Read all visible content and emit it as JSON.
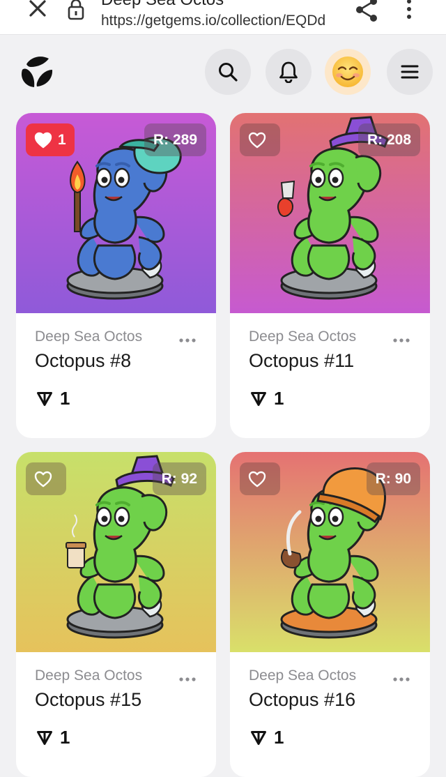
{
  "browser": {
    "title": "Deep Sea Octos",
    "url": "https://getgems.io/collection/EQDd"
  },
  "header": {
    "logo_icon": "getgems-logo-icon",
    "search_icon": "search-icon",
    "bell_icon": "bell-icon",
    "avatar_icon": "smiling-emoji-avatar",
    "menu_icon": "hamburger-menu-icon"
  },
  "cards": [
    {
      "collection": "Deep Sea Octos",
      "name": "Octopus #8",
      "likes": "1",
      "liked": true,
      "rank": "R: 289",
      "price": "1",
      "bg_top": "#c75ad6",
      "bg_bottom": "#8f5ad9",
      "body": "#4a7ad1",
      "hat": "cap",
      "hat_color": "#5ed3c0",
      "base": "#a0a4a8",
      "holding": "torch"
    },
    {
      "collection": "Deep Sea Octos",
      "name": "Octopus #11",
      "likes": "",
      "liked": false,
      "rank": "R: 208",
      "price": "1",
      "bg_top": "#e27272",
      "bg_bottom": "#c65ad0",
      "body": "#6fd14a",
      "hat": "bucket",
      "hat_color": "#8a4fd6",
      "base": "#a0a4a8",
      "holding": "lamp"
    },
    {
      "collection": "Deep Sea Octos",
      "name": "Octopus #15",
      "likes": "",
      "liked": false,
      "rank": "R: 92",
      "price": "1",
      "bg_top": "#c7e06a",
      "bg_bottom": "#e6c25c",
      "body": "#6fd14a",
      "hat": "bucket",
      "hat_color": "#8a4fd6",
      "base": "#a0a4a8",
      "holding": "coffee"
    },
    {
      "collection": "Deep Sea Octos",
      "name": "Octopus #16",
      "likes": "",
      "liked": false,
      "rank": "R: 90",
      "price": "1",
      "bg_top": "#e57272",
      "bg_bottom": "#d9e06a",
      "body": "#6fd14a",
      "hat": "beanie",
      "hat_color": "#f19a3e",
      "base": "#e8893a",
      "holding": "pipe"
    }
  ],
  "colors": {
    "like_active": "#ee3344",
    "page_bg": "#f1f1f3"
  }
}
